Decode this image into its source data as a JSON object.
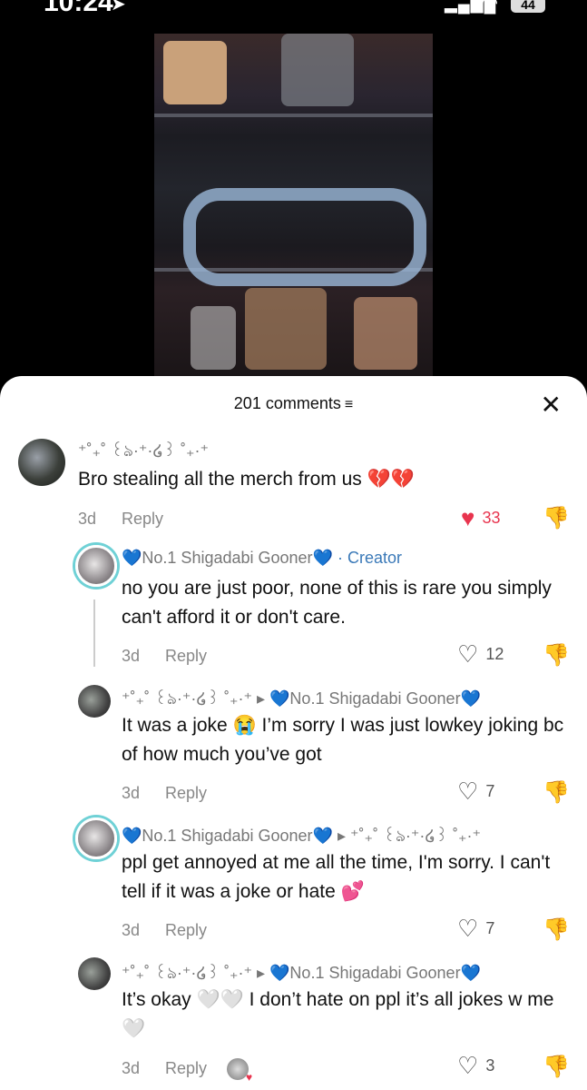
{
  "status_bar": {
    "time": "10:24",
    "battery": "44"
  },
  "sheet": {
    "title": "201 comments",
    "filter_icon": "≡",
    "close_icon": "✕"
  },
  "comments": [
    {
      "username": "⁺˚₊˚ ꒰ঌ·⁺·໒꒱ ˚₊·⁺",
      "text": "Bro stealing all the merch from us 💔💔",
      "time": "3d",
      "reply_label": "Reply",
      "likes": "33",
      "liked": true
    },
    {
      "username": "💙No.1 Shigadabi Gooner💙",
      "creator_label": "· Creator",
      "text": "no you are just poor, none of this is rare you simply can't afford it or don't care.",
      "time": "3d",
      "reply_label": "Reply",
      "likes": "12"
    },
    {
      "username": "⁺˚₊˚ ꒰ঌ·⁺·໒꒱ ˚₊·⁺",
      "reply_to": "▸ 💙No.1 Shigadabi Gooner💙",
      "text": "It was a joke 😭 I’m sorry I was just lowkey joking bc of how much you’ve got",
      "time": "3d",
      "reply_label": "Reply",
      "likes": "7"
    },
    {
      "username": "💙No.1 Shigadabi Gooner💙",
      "reply_to": "▸ ⁺˚₊˚ ꒰ঌ·⁺·໒꒱ ˚₊·⁺",
      "text": "ppl get annoyed at me all the time, I'm sorry. I can't tell if it was a joke or hate 💕",
      "time": "3d",
      "reply_label": "Reply",
      "likes": "7"
    },
    {
      "username": "⁺˚₊˚ ꒰ঌ·⁺·໒꒱ ˚₊·⁺",
      "reply_to": "▸ 💙No.1 Shigadabi Gooner💙",
      "text": "It’s okay 🤍🤍 I don’t hate on ppl it’s all jokes w me 🤍",
      "time": "3d",
      "reply_label": "Reply",
      "likes": "3"
    }
  ]
}
